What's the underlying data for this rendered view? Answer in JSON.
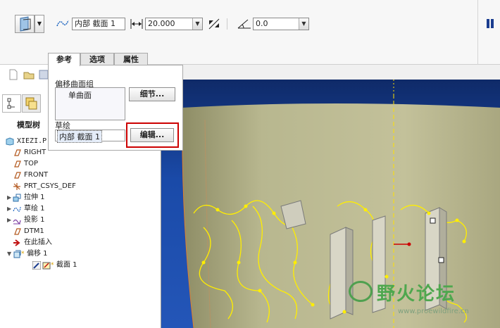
{
  "dashboard": {
    "reference_type": "内部 截面 1",
    "offset_value": "20.000",
    "angle_value": "0.0"
  },
  "tabs": [
    {
      "label": "参考"
    },
    {
      "label": "选项"
    },
    {
      "label": "属性"
    }
  ],
  "references_panel": {
    "offset_surface_group_label": "偏移曲面组",
    "surface_item": "单曲面",
    "details_button": "细节...",
    "sketch_label": "草绘",
    "sketch_value": "内部 截面 1",
    "edit_button": "编辑..."
  },
  "model_tree": {
    "header": "模型树",
    "root": "XIEZI.P",
    "items": [
      {
        "label": "RIGHT",
        "icon": "datum-plane-icon"
      },
      {
        "label": "TOP",
        "icon": "datum-plane-icon"
      },
      {
        "label": "FRONT",
        "icon": "datum-plane-icon"
      },
      {
        "label": "PRT_CSYS_DEF",
        "icon": "coordinate-system-icon"
      },
      {
        "label": "拉伸 1",
        "icon": "extrude-icon"
      },
      {
        "label": "草绘 1",
        "icon": "sketch-icon"
      },
      {
        "label": "投影 1",
        "icon": "projection-icon"
      },
      {
        "label": "DTM1",
        "icon": "datum-plane-icon"
      },
      {
        "label": "在此插入",
        "icon": "insert-here-arrow-icon"
      },
      {
        "label": "偏移 1",
        "icon": "offset-icon"
      },
      {
        "label": "截面 1",
        "icon": "section-icon"
      }
    ]
  },
  "watermark": {
    "text": "野火论坛",
    "url": "www.proewildfire.cn"
  },
  "colors": {
    "highlight_box": "#cc0000",
    "viewport_bg": "#1a4aa8",
    "model_surface": "#b7b58a",
    "sketch_yellow": "#ffee00"
  }
}
